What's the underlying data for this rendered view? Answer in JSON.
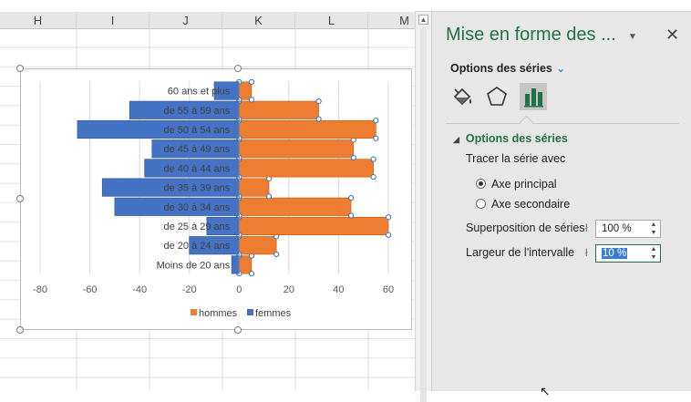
{
  "columns": [
    "H",
    "I",
    "J",
    "K",
    "L",
    "M"
  ],
  "panel": {
    "title": "Mise en forme des ...",
    "section_dropdown": "Options des séries",
    "tabs": [
      "fill-line",
      "effects",
      "series-options"
    ],
    "section_header": "Options des séries",
    "plot_on_label": "Tracer la série avec",
    "radio_primary": "Axe principal",
    "radio_secondary": "Axe secondaire",
    "overlap_label": "Superposition de séries",
    "overlap_value": "100 %",
    "gap_label": "Largeur de l'intervalle",
    "gap_value": "10 %"
  },
  "chart_data": {
    "type": "bar",
    "orientation": "horizontal",
    "categories": [
      "Moins de 20 ans",
      "de 20 à 24 ans",
      "de 25 à 29 ans",
      "de 30 à 34 ans",
      "de 35 à 39 ans",
      "de 40 à 44 ans",
      "de 45 à 49 ans",
      "de 50 à 54 ans",
      "de 55 à 59 ans",
      "60 ans et plus"
    ],
    "series": [
      {
        "name": "hommes",
        "color": "#ed7d31",
        "values": [
          5,
          15,
          60,
          45,
          12,
          54,
          46,
          55,
          32,
          5
        ]
      },
      {
        "name": "femmes",
        "color": "#4472c4",
        "values": [
          -3,
          -20,
          -13,
          -50,
          -55,
          -38,
          -35,
          -65,
          -44,
          -10
        ]
      }
    ],
    "xticks": [
      -80,
      -60,
      -40,
      -20,
      0,
      20,
      40,
      60
    ],
    "xlim": [
      -80,
      60
    ],
    "grid": true,
    "legend": "bottom"
  }
}
